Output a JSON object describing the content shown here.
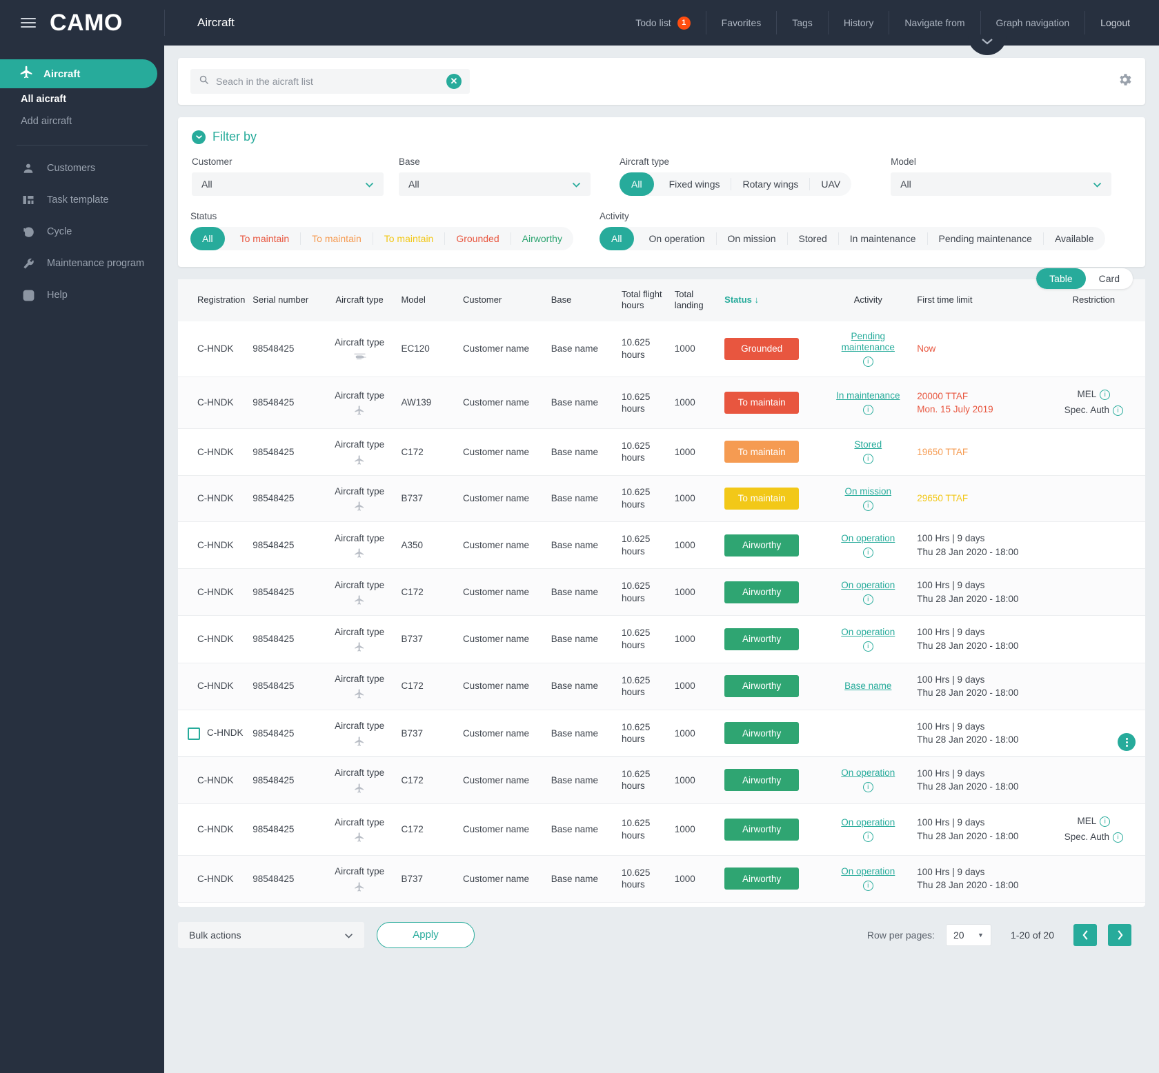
{
  "brand": {
    "title": "CAMO",
    "menu_icon": "hamburger-icon"
  },
  "header": {
    "page_title": "Aircraft",
    "nav": [
      {
        "label": "Todo list",
        "badge": "1"
      },
      {
        "label": "Favorites",
        "badge": ""
      },
      {
        "label": "Tags",
        "badge": ""
      },
      {
        "label": "History",
        "badge": ""
      },
      {
        "label": "Navigate from",
        "badge": ""
      },
      {
        "label": "Graph navigation",
        "badge": ""
      },
      {
        "label": "Logout",
        "badge": ""
      }
    ]
  },
  "sidebar": {
    "primary": {
      "label": "Aircraft",
      "icon": "airplane-icon"
    },
    "sub_items": [
      {
        "label": "All aicraft",
        "active": true
      },
      {
        "label": "Add aircraft",
        "active": false
      }
    ],
    "items": [
      {
        "label": "Customers",
        "icon": "person-icon"
      },
      {
        "label": "Task template",
        "icon": "grid-icon"
      },
      {
        "label": "Cycle",
        "icon": "refresh-icon"
      },
      {
        "label": "Maintenance program",
        "icon": "wrench-icon"
      },
      {
        "label": "Help",
        "icon": "question-icon"
      }
    ]
  },
  "search": {
    "placeholder": "Seach in the aicraft list",
    "value": "",
    "icon": "search-icon",
    "clear_icon": "clear-icon",
    "settings_icon": "gear-icon"
  },
  "filter": {
    "title": "Filter by",
    "customer": {
      "label": "Customer",
      "value": "All"
    },
    "base": {
      "label": "Base",
      "value": "All"
    },
    "aircraft_type": {
      "label": "Aircraft type",
      "all_label": "All",
      "options": [
        "Fixed wings",
        "Rotary wings",
        "UAV"
      ]
    },
    "model": {
      "label": "Model",
      "value": "All"
    },
    "status": {
      "label": "Status",
      "all_label": "All",
      "options": [
        {
          "label": "To maintain",
          "color": "#e8563f"
        },
        {
          "label": "To maintain",
          "color": "#f59b52"
        },
        {
          "label": "To maintain",
          "color": "#f2c818"
        },
        {
          "label": "Grounded",
          "color": "#e8563f"
        },
        {
          "label": "Airworthy",
          "color": "#2fa572"
        }
      ]
    },
    "activity": {
      "label": "Activity",
      "all_label": "All",
      "options": [
        "On operation",
        "On mission",
        "Stored",
        "In maintenance",
        "Pending maintenance",
        "Available"
      ]
    }
  },
  "view_toggle": {
    "table": "Table",
    "card": "Card",
    "active": "Table"
  },
  "table": {
    "columns": [
      "Registration",
      "Serial number",
      "Aircraft type",
      "Model",
      "Customer",
      "Base",
      "Total flight hours",
      "Total landing",
      "Status",
      "Activity",
      "First time limit",
      "Restriction"
    ],
    "sorted_column": "Status",
    "sort_icon": "arrow-down-icon",
    "rows": [
      {
        "registration": "C-HNDK",
        "serial": "98548425",
        "aircraft_type": "Aircraft type",
        "type_icon": "helicopter-icon",
        "model": "EC120",
        "customer": "Customer name",
        "base": "Base name",
        "hours": "10.625 hours",
        "landing": "1000",
        "status": "Grounded",
        "status_color": "#e8563f",
        "activity": "Pending maintenance",
        "activity_info": true,
        "ftl": "Now",
        "ftl_color": "#e8563f",
        "restriction": []
      },
      {
        "registration": "C-HNDK",
        "serial": "98548425",
        "aircraft_type": "Aircraft type",
        "type_icon": "airplane-icon",
        "model": "AW139",
        "customer": "Customer name",
        "base": "Base name",
        "hours": "10.625 hours",
        "landing": "1000",
        "status": "To maintain",
        "status_color": "#e8563f",
        "activity": "In maintenance",
        "activity_info": true,
        "ftl": "20000 TTAF\nMon. 15 July 2019",
        "ftl_color": "#e8563f",
        "restriction": [
          "MEL",
          "Spec. Auth"
        ]
      },
      {
        "registration": "C-HNDK",
        "serial": "98548425",
        "aircraft_type": "Aircraft type",
        "type_icon": "airplane-icon",
        "model": "C172",
        "customer": "Customer name",
        "base": "Base name",
        "hours": "10.625 hours",
        "landing": "1000",
        "status": "To maintain",
        "status_color": "#f59b52",
        "activity": "Stored",
        "activity_info": true,
        "ftl": "19650 TTAF",
        "ftl_color": "#f59b52",
        "restriction": []
      },
      {
        "registration": "C-HNDK",
        "serial": "98548425",
        "aircraft_type": "Aircraft type",
        "type_icon": "airplane-icon",
        "model": "B737",
        "customer": "Customer name",
        "base": "Base name",
        "hours": "10.625 hours",
        "landing": "1000",
        "status": "To maintain",
        "status_color": "#f2c818",
        "activity": "On mission",
        "activity_info": true,
        "ftl": "29650 TTAF",
        "ftl_color": "#f2c818",
        "restriction": []
      },
      {
        "registration": "C-HNDK",
        "serial": "98548425",
        "aircraft_type": "Aircraft type",
        "type_icon": "airplane-icon",
        "model": "A350",
        "customer": "Customer name",
        "base": "Base name",
        "hours": "10.625 hours",
        "landing": "1000",
        "status": "Airworthy",
        "status_color": "#2fa572",
        "activity": "On operation",
        "activity_info": true,
        "ftl": "100 Hrs | 9 days\nThu 28 Jan 2020 - 18:00",
        "ftl_color": "#3f454e",
        "restriction": []
      },
      {
        "registration": "C-HNDK",
        "serial": "98548425",
        "aircraft_type": "Aircraft type",
        "type_icon": "airplane-icon",
        "model": "C172",
        "customer": "Customer name",
        "base": "Base name",
        "hours": "10.625 hours",
        "landing": "1000",
        "status": "Airworthy",
        "status_color": "#2fa572",
        "activity": "On operation",
        "activity_info": true,
        "ftl": "100 Hrs | 9 days\nThu 28 Jan 2020 - 18:00",
        "ftl_color": "#3f454e",
        "restriction": []
      },
      {
        "registration": "C-HNDK",
        "serial": "98548425",
        "aircraft_type": "Aircraft type",
        "type_icon": "airplane-icon",
        "model": "B737",
        "customer": "Customer name",
        "base": "Base name",
        "hours": "10.625 hours",
        "landing": "1000",
        "status": "Airworthy",
        "status_color": "#2fa572",
        "activity": "On operation",
        "activity_info": true,
        "ftl": "100 Hrs | 9 days\nThu 28 Jan 2020 - 18:00",
        "ftl_color": "#3f454e",
        "restriction": []
      },
      {
        "registration": "C-HNDK",
        "serial": "98548425",
        "aircraft_type": "Aircraft type",
        "type_icon": "airplane-icon",
        "model": "C172",
        "customer": "Customer name",
        "base": "Base name",
        "hours": "10.625 hours",
        "landing": "1000",
        "status": "Airworthy",
        "status_color": "#2fa572",
        "activity": "Base name",
        "activity_info": false,
        "ftl": "100 Hrs | 9 days\nThu 28 Jan 2020 - 18:00",
        "ftl_color": "#3f454e",
        "restriction": []
      },
      {
        "registration": "C-HNDK",
        "serial": "98548425",
        "aircraft_type": "Aircraft type",
        "type_icon": "airplane-icon",
        "model": "B737",
        "customer": "Customer name",
        "base": "Base name",
        "hours": "10.625 hours",
        "landing": "1000",
        "status": "Airworthy",
        "status_color": "#2fa572",
        "activity": "",
        "activity_info": false,
        "ftl": "100 Hrs | 9 days\nThu 28 Jan 2020 - 18:00",
        "ftl_color": "#3f454e",
        "restriction": [],
        "selected": true,
        "has_kebab": true
      },
      {
        "registration": "C-HNDK",
        "serial": "98548425",
        "aircraft_type": "Aircraft type",
        "type_icon": "airplane-icon",
        "model": "C172",
        "customer": "Customer name",
        "base": "Base name",
        "hours": "10.625 hours",
        "landing": "1000",
        "status": "Airworthy",
        "status_color": "#2fa572",
        "activity": "On operation",
        "activity_info": true,
        "ftl": "100 Hrs | 9 days\nThu 28 Jan 2020 - 18:00",
        "ftl_color": "#3f454e",
        "restriction": []
      },
      {
        "registration": "C-HNDK",
        "serial": "98548425",
        "aircraft_type": "Aircraft type",
        "type_icon": "airplane-icon",
        "model": "C172",
        "customer": "Customer name",
        "base": "Base name",
        "hours": "10.625 hours",
        "landing": "1000",
        "status": "Airworthy",
        "status_color": "#2fa572",
        "activity": "On operation",
        "activity_info": true,
        "ftl": "100 Hrs | 9 days\nThu 28 Jan 2020 - 18:00",
        "ftl_color": "#3f454e",
        "restriction": [
          "MEL",
          "Spec. Auth"
        ]
      },
      {
        "registration": "C-HNDK",
        "serial": "98548425",
        "aircraft_type": "Aircraft type",
        "type_icon": "airplane-icon",
        "model": "B737",
        "customer": "Customer name",
        "base": "Base name",
        "hours": "10.625 hours",
        "landing": "1000",
        "status": "Airworthy",
        "status_color": "#2fa572",
        "activity": "On operation",
        "activity_info": true,
        "ftl": "100 Hrs | 9 days\nThu 28 Jan 2020 - 18:00",
        "ftl_color": "#3f454e",
        "restriction": []
      }
    ]
  },
  "footer": {
    "bulk_actions": "Bulk actions",
    "apply": "Apply",
    "rows_per_page_label": "Row per pages:",
    "rows_per_page_value": "20",
    "range": "1-20 of 20",
    "prev_icon": "chevron-left-icon",
    "next_icon": "chevron-right-icon"
  },
  "colors": {
    "accent": "#27ab9b",
    "dark": "#27303f",
    "danger": "#e8563f",
    "warn": "#f59b52",
    "yellow": "#f2c818",
    "green": "#2fa572"
  }
}
